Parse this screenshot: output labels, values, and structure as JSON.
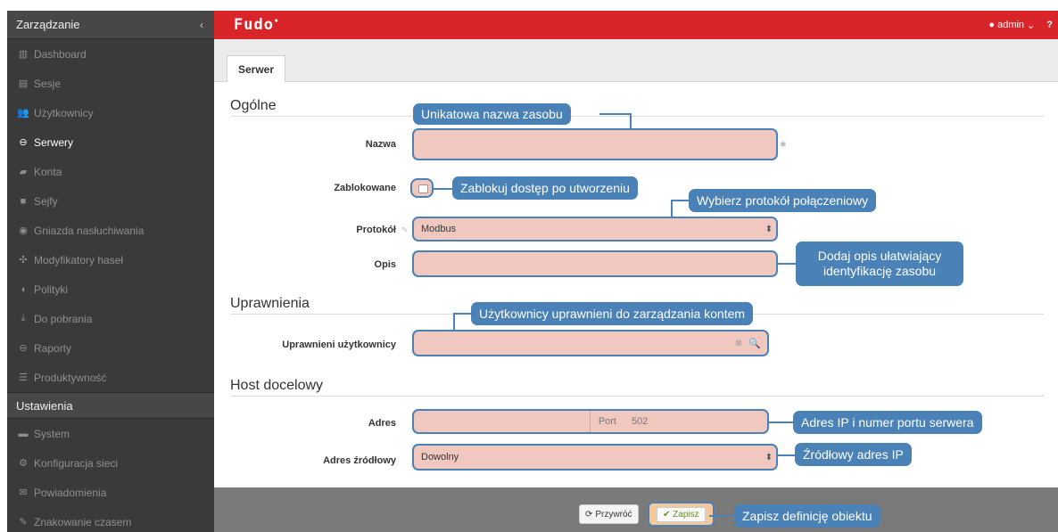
{
  "sidebar": {
    "title": "Zarządzanie",
    "collapse_icon": "‹",
    "items": [
      {
        "icon": "▥",
        "label": "Dashboard"
      },
      {
        "icon": "▤",
        "label": "Sesje"
      },
      {
        "icon": "👥",
        "label": "Użytkownicy"
      },
      {
        "icon": "⊖",
        "label": "Serwery",
        "active": true
      },
      {
        "icon": "▰",
        "label": "Konta"
      },
      {
        "icon": "■",
        "label": "Sejfy"
      },
      {
        "icon": "◉",
        "label": "Gniazda nasłuchiwania"
      },
      {
        "icon": "✣",
        "label": "Modyfikatory haseł"
      },
      {
        "icon": "◖",
        "label": "Polityki"
      },
      {
        "icon": "⤓",
        "label": "Do pobrania"
      },
      {
        "icon": "⊖",
        "label": "Raporty"
      },
      {
        "icon": "☰",
        "label": "Produktywność"
      }
    ],
    "settings_title": "Ustawienia",
    "settings_items": [
      {
        "icon": "▬",
        "label": "System"
      },
      {
        "icon": "⚙",
        "label": "Konfiguracja sieci"
      },
      {
        "icon": "✉",
        "label": "Powiadomienia"
      },
      {
        "icon": "✎",
        "label": "Znakowanie czasem"
      }
    ]
  },
  "topbar": {
    "logo": "Fudo",
    "user": "admin",
    "user_caret": "⌄",
    "help": "?"
  },
  "tabs": {
    "active": "Serwer"
  },
  "form": {
    "section_general": "Ogólne",
    "label_name": "Nazwa",
    "label_blocked": "Zablokowane",
    "label_protocol": "Protokół",
    "protocol_value": "Modbus",
    "label_description": "Opis",
    "section_permissions": "Uprawnienia",
    "label_privileged_users": "Uprawnieni użytkownicy",
    "section_target_host": "Host docelowy",
    "label_address": "Adres",
    "port_label": "Port",
    "port_value": "502",
    "label_source_address": "Adres źródłowy",
    "source_address_value": "Dowolny"
  },
  "footer": {
    "reset_label": "Przywróć",
    "save_label": "Zapisz"
  },
  "callouts": {
    "name": "Unikatowa nazwa zasobu",
    "blocked": "Zablokuj dostęp po utworzeniu",
    "protocol": "Wybierz protokół połączeniowy",
    "description_line1": "Dodaj opis ułatwiający",
    "description_line2": "identyfikację zasobu",
    "privileged": "Użytkownicy uprawnieni do zarządzania kontem",
    "address": "Adres IP i numer portu serwera",
    "source": "Źródłowy adres IP",
    "save": "Zapisz definicję obiektu"
  },
  "colors": {
    "brand_red": "#d9252a",
    "callout_blue": "#4a82b8",
    "field_highlight": "#f1c8c0",
    "sidebar_bg": "#3a3a3a"
  }
}
